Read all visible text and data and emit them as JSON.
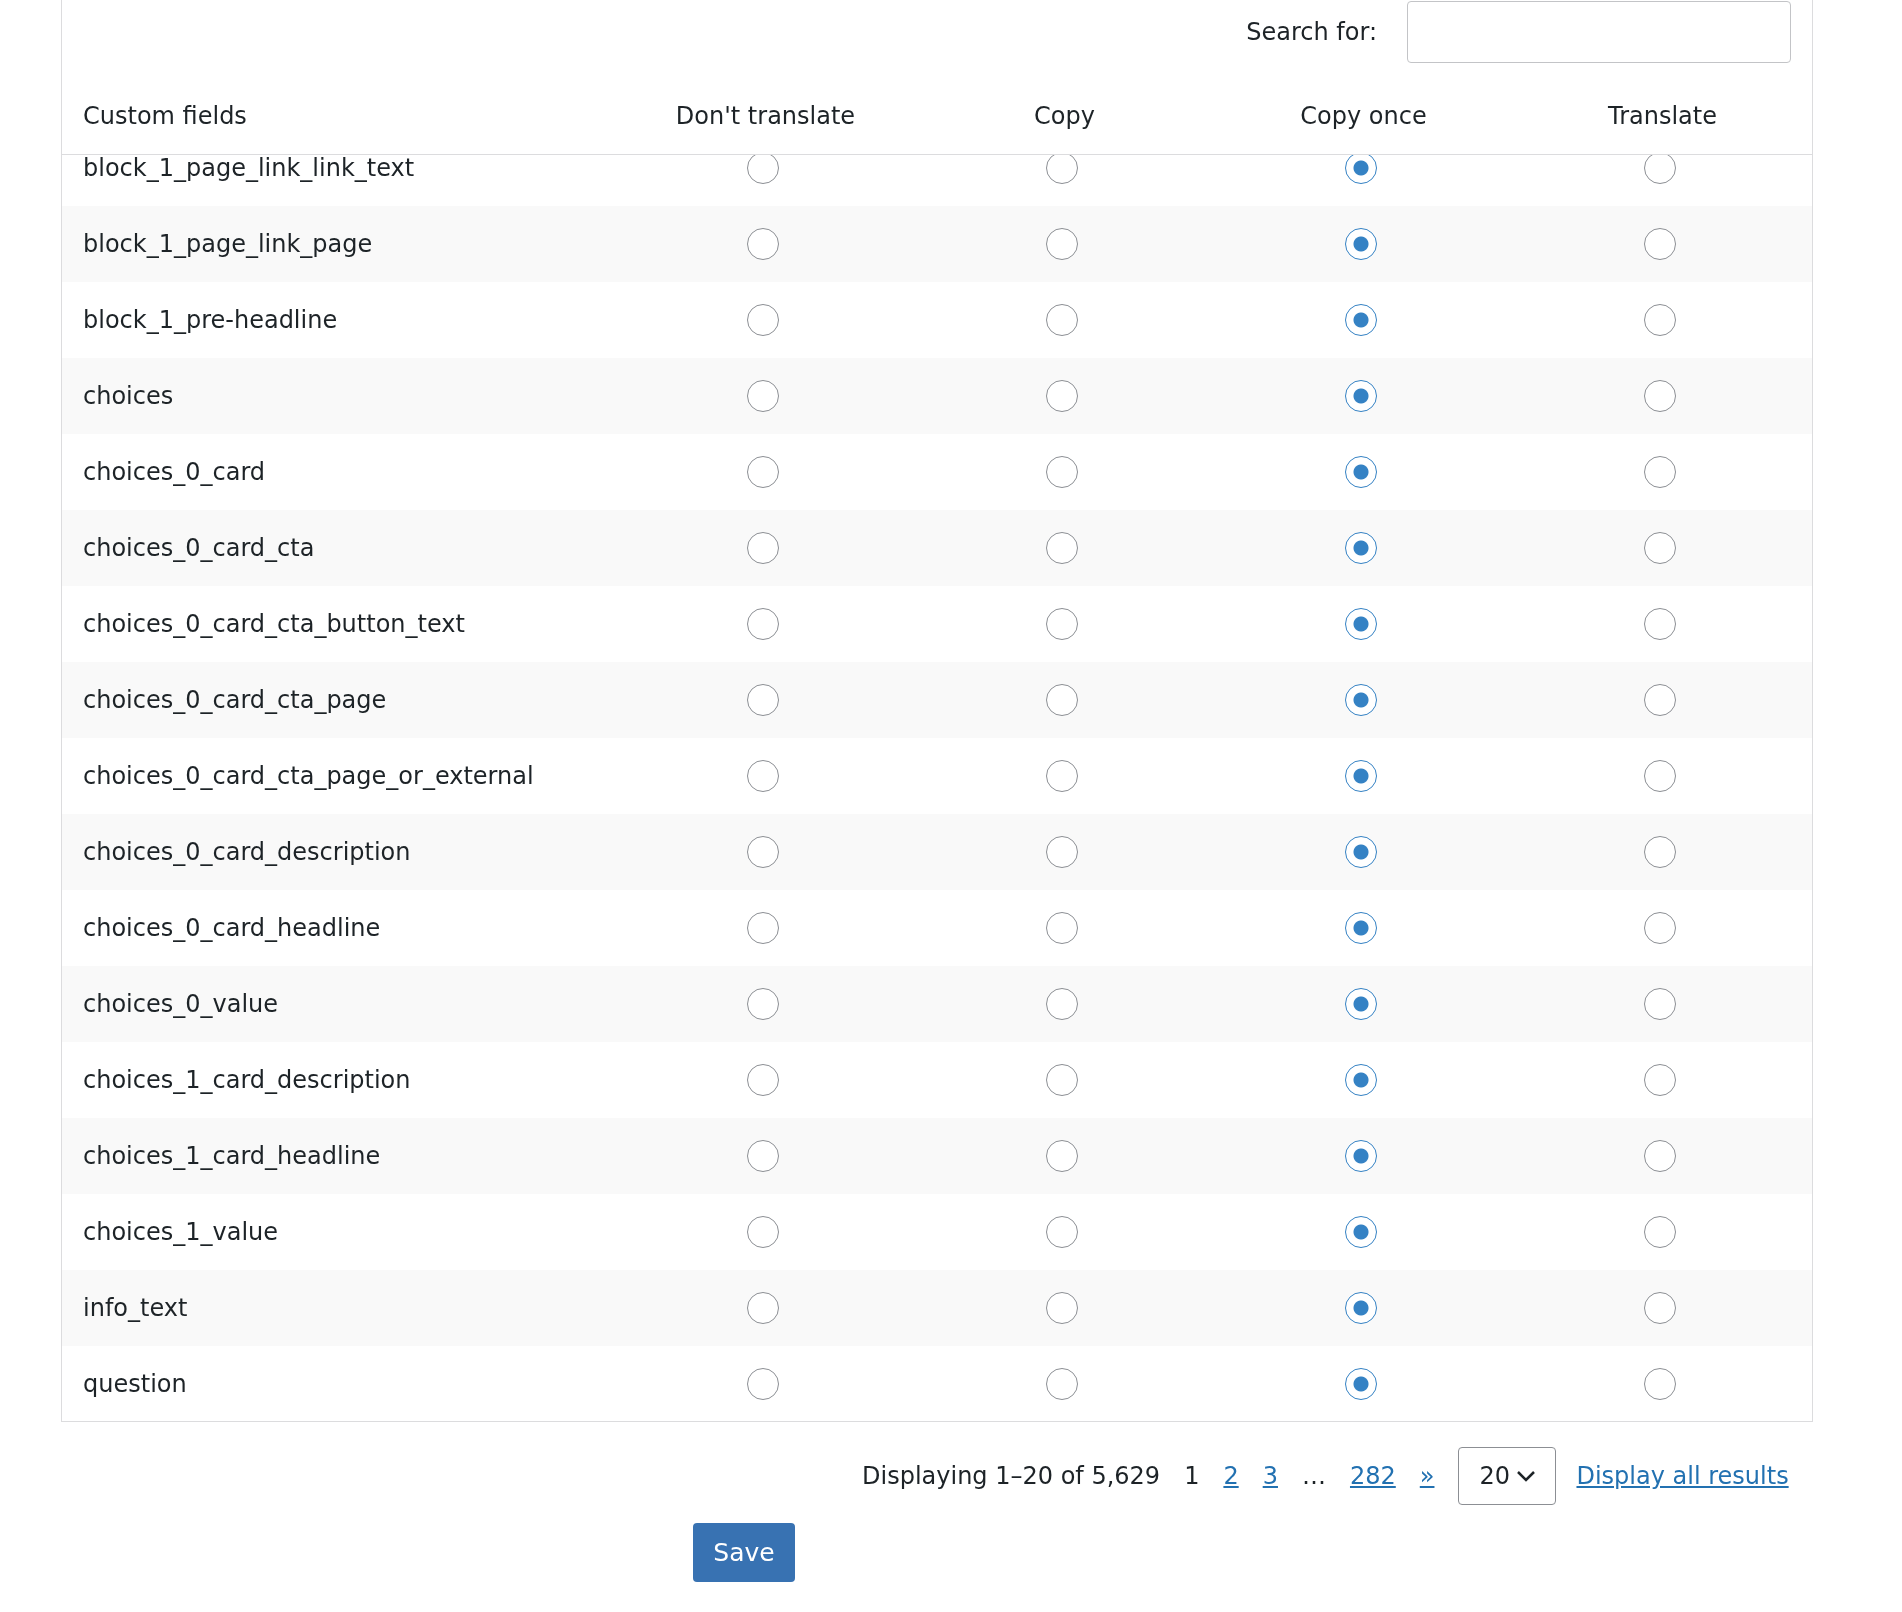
{
  "search": {
    "label": "Search for:"
  },
  "columns": [
    "Custom fields",
    "Don't translate",
    "Copy",
    "Copy once",
    "Translate"
  ],
  "rows": [
    {
      "field": "block_1_page_link_link_text",
      "options": [
        {
          "selected": false
        },
        {
          "selected": false
        },
        {
          "selected": true
        },
        {
          "selected": false
        }
      ]
    },
    {
      "field": "block_1_page_link_page",
      "options": [
        {
          "selected": false
        },
        {
          "selected": false
        },
        {
          "selected": true
        },
        {
          "selected": false
        }
      ]
    },
    {
      "field": "block_1_pre-headline",
      "options": [
        {
          "selected": false
        },
        {
          "selected": false
        },
        {
          "selected": true
        },
        {
          "selected": false
        }
      ]
    },
    {
      "field": "choices",
      "options": [
        {
          "selected": false
        },
        {
          "selected": false
        },
        {
          "selected": true
        },
        {
          "selected": false
        }
      ]
    },
    {
      "field": "choices_0_card",
      "options": [
        {
          "selected": false
        },
        {
          "selected": false
        },
        {
          "selected": true
        },
        {
          "selected": false
        }
      ]
    },
    {
      "field": "choices_0_card_cta",
      "options": [
        {
          "selected": false
        },
        {
          "selected": false
        },
        {
          "selected": true
        },
        {
          "selected": false
        }
      ]
    },
    {
      "field": "choices_0_card_cta_button_text",
      "options": [
        {
          "selected": false
        },
        {
          "selected": false
        },
        {
          "selected": true
        },
        {
          "selected": false
        }
      ]
    },
    {
      "field": "choices_0_card_cta_page",
      "options": [
        {
          "selected": false
        },
        {
          "selected": false
        },
        {
          "selected": true
        },
        {
          "selected": false
        }
      ]
    },
    {
      "field": "choices_0_card_cta_page_or_external",
      "options": [
        {
          "selected": false
        },
        {
          "selected": false
        },
        {
          "selected": true
        },
        {
          "selected": false
        }
      ]
    },
    {
      "field": "choices_0_card_description",
      "options": [
        {
          "selected": false
        },
        {
          "selected": false
        },
        {
          "selected": true
        },
        {
          "selected": false
        }
      ]
    },
    {
      "field": "choices_0_card_headline",
      "options": [
        {
          "selected": false
        },
        {
          "selected": false
        },
        {
          "selected": true
        },
        {
          "selected": false
        }
      ]
    },
    {
      "field": "choices_0_value",
      "options": [
        {
          "selected": false
        },
        {
          "selected": false
        },
        {
          "selected": true
        },
        {
          "selected": false
        }
      ]
    },
    {
      "field": "choices_1_card_description",
      "options": [
        {
          "selected": false
        },
        {
          "selected": false
        },
        {
          "selected": true
        },
        {
          "selected": false
        }
      ]
    },
    {
      "field": "choices_1_card_headline",
      "options": [
        {
          "selected": false
        },
        {
          "selected": false
        },
        {
          "selected": true
        },
        {
          "selected": false
        }
      ]
    },
    {
      "field": "choices_1_value",
      "options": [
        {
          "selected": false
        },
        {
          "selected": false
        },
        {
          "selected": true
        },
        {
          "selected": false
        }
      ]
    },
    {
      "field": "info_text",
      "options": [
        {
          "selected": false
        },
        {
          "selected": false
        },
        {
          "selected": true
        },
        {
          "selected": false
        }
      ]
    },
    {
      "field": "question",
      "options": [
        {
          "selected": false
        },
        {
          "selected": false
        },
        {
          "selected": true
        },
        {
          "selected": false
        }
      ]
    }
  ],
  "pagination": {
    "summary": "Displaying 1–20 of 5,629",
    "pages": [
      {
        "label": "1",
        "selected": true
      },
      {
        "label": "2",
        "selected": false
      },
      {
        "label": "3",
        "selected": false
      },
      {
        "label": "…",
        "kind": "ellipsis"
      },
      {
        "label": "282",
        "selected": false
      },
      {
        "label": "»",
        "selected": false
      }
    ],
    "per_page": "20",
    "display_all": "Display all results"
  },
  "save_button": "Save"
}
